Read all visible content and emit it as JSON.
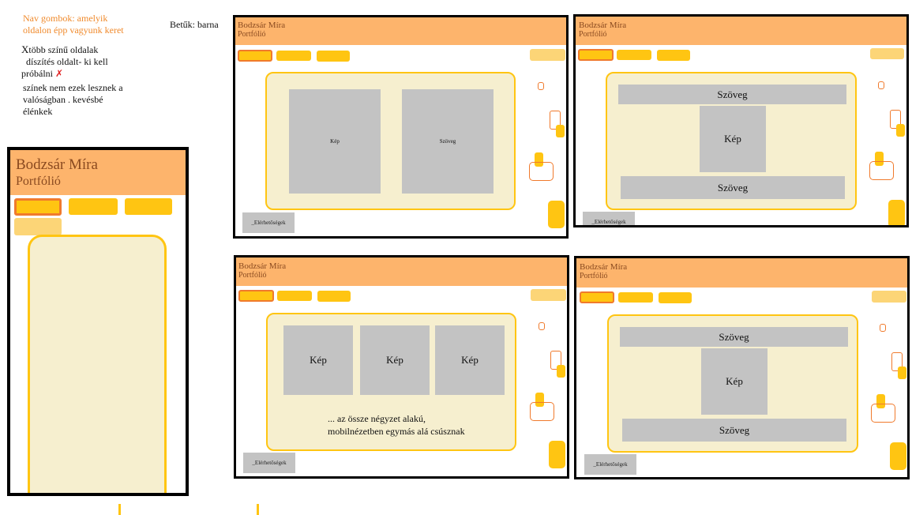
{
  "notes": {
    "nav_note_line1": "Nav gombok: amelyik",
    "nav_note_line2": "oldalon épp vagyunk keret",
    "letters_note": "Betűk: barna",
    "multi_prefix": "X",
    "multi_line1": "több színű oldalak",
    "multi_line2": "díszítés oldalt- ki kell",
    "multi_line3": "próbálni",
    "cross_icon": "✗",
    "colors_line1": "színek nem ezek lesznek a",
    "colors_line2": "valóságban . kevésbé",
    "colors_line3": "élénkek"
  },
  "site": {
    "title": "Bodzsár Míra",
    "subtitle": "Portfólió",
    "footer_label": "_Elérhetőségek"
  },
  "mockups": {
    "m1": {
      "left_label": "Kép",
      "right_label": "Szöveg"
    },
    "m2": {
      "top": "Szöveg",
      "image": "Kép",
      "bottom": "Szöveg"
    },
    "m3": {
      "img1": "Kép",
      "img2": "Kép",
      "img3": "Kép",
      "caption_line1": "... az össze négyzet alakú,",
      "caption_line2": "mobilnézetben egymás alá csúsznak"
    },
    "m4": {
      "top": "Szöveg",
      "image": "Kép",
      "bottom": "Szöveg"
    }
  },
  "colors": {
    "header": "#fdb46c",
    "nav": "#ffc512",
    "nav_pale": "#fcd577",
    "active_border": "#f07a2c",
    "content_bg": "#f6efcf",
    "placeholder": "#c3c3c3",
    "title_text": "#8a4a20"
  }
}
